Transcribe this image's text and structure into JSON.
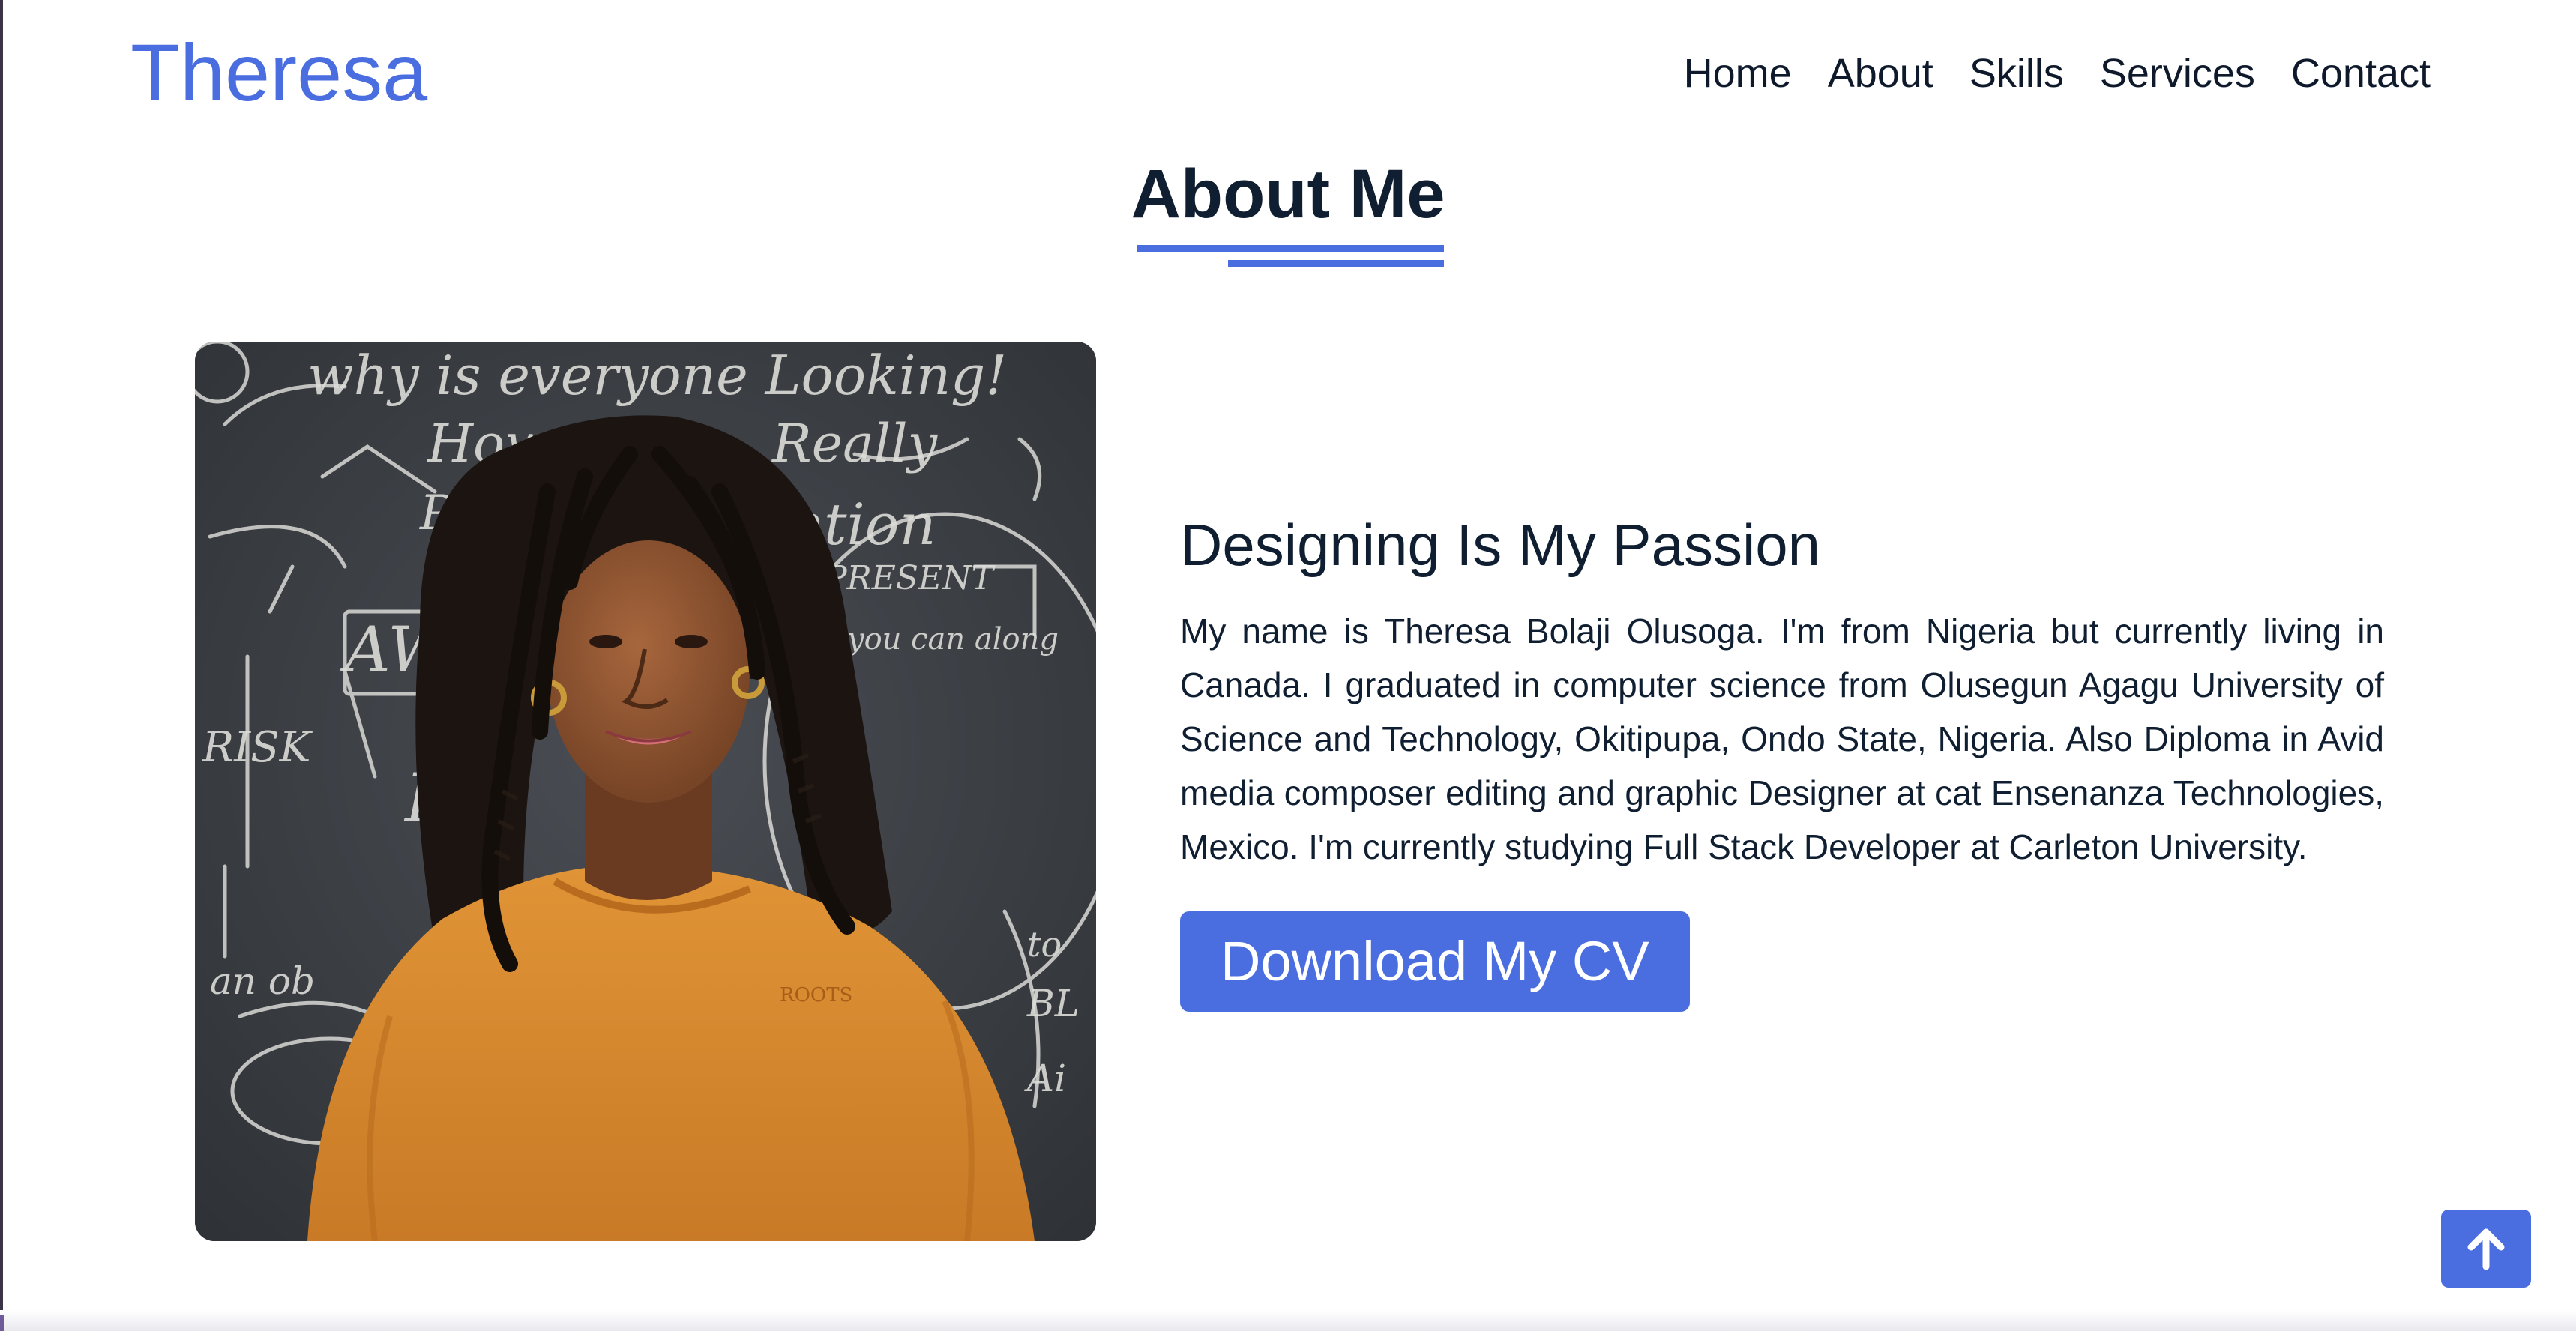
{
  "header": {
    "logo": "Theresa",
    "nav": [
      "Home",
      "About",
      "Skills",
      "Services",
      "Contact"
    ]
  },
  "section": {
    "title": "About Me"
  },
  "about": {
    "heading": "Designing Is My Passion",
    "paragraph": "My name is Theresa Bolaji Olusoga. I'm from Nigeria but currently living in Canada. I graduated in computer science from Olusegun Agagu University of Science and Technology, Okitipupa, Ondo State, Nigeria. Also Diploma in Avid media composer editing and graphic Designer at cat Ensenanza Technologies, Mexico. I'm currently studying Full Stack Developer at Carleton University.",
    "button_label": "Download My CV"
  },
  "photo": {
    "chalk_text": [
      "why is everyone Looking!",
      "How m",
      "Really",
      "PAY",
      "ntion",
      "PRESENT",
      "AWARE",
      "you can along",
      "RISK",
      "Fo",
      "an ob",
      "Ai",
      "BL",
      "to"
    ],
    "sweater_label": "ROOTS"
  },
  "icons": {
    "scroll_top": "arrow-up-icon"
  },
  "colors": {
    "accent": "#4a6ee0",
    "text": "#0f1e30",
    "sweater": "#d8892f",
    "chalkboard": "#3a3d42"
  }
}
